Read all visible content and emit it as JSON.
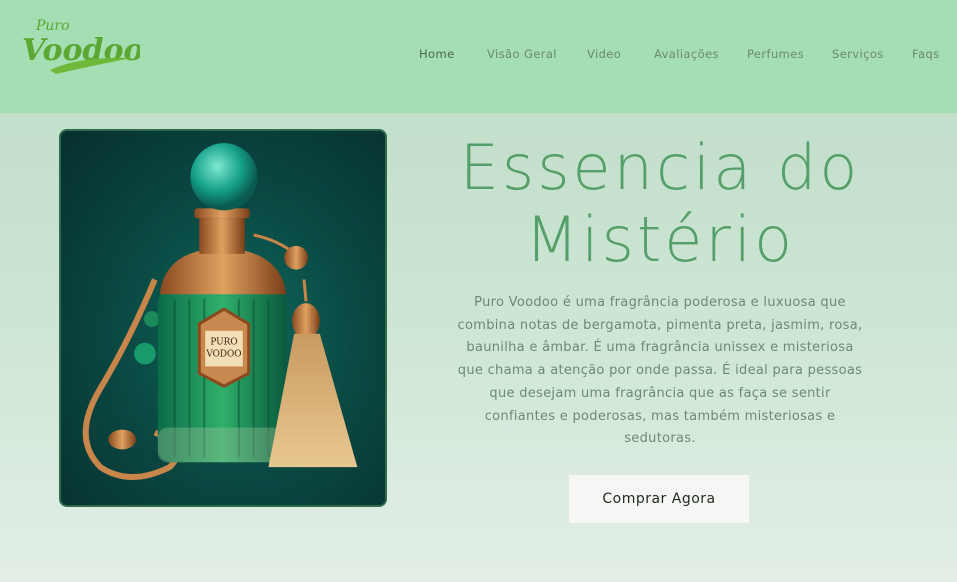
{
  "header": {
    "logo_small": "Puro",
    "logo_large": "Voodoo",
    "nav": [
      {
        "label": "Home",
        "active": true
      },
      {
        "label": "Visão Geral",
        "active": false
      },
      {
        "label": "Video",
        "active": false
      },
      {
        "label": "Avaliações",
        "active": false
      },
      {
        "label": "Perfumes",
        "active": false
      },
      {
        "label": "Serviços",
        "active": false
      },
      {
        "label": "Faqs",
        "active": false
      }
    ]
  },
  "hero": {
    "title_line1": "Essencia do",
    "title_line2": "Mistério",
    "description": "Puro Voodoo é uma fragrância poderosa e luxuosa que combina notas de bergamota, pimenta preta, jasmim, rosa, baunilha e âmbar. É uma fragrância unissex e misteriosa que chama a atenção por onde passa. É ideal para pessoas que desejam uma fragrância que as faça se sentir confiantes e poderosas, mas também misteriosas e sedutoras.",
    "cta_label": "Comprar Agora",
    "image_label_line1": "PURO",
    "image_label_line2": "VODOO"
  },
  "colors": {
    "header_bg": "#a4deb2",
    "title": "#55a06a",
    "logo": "#5aa832"
  }
}
